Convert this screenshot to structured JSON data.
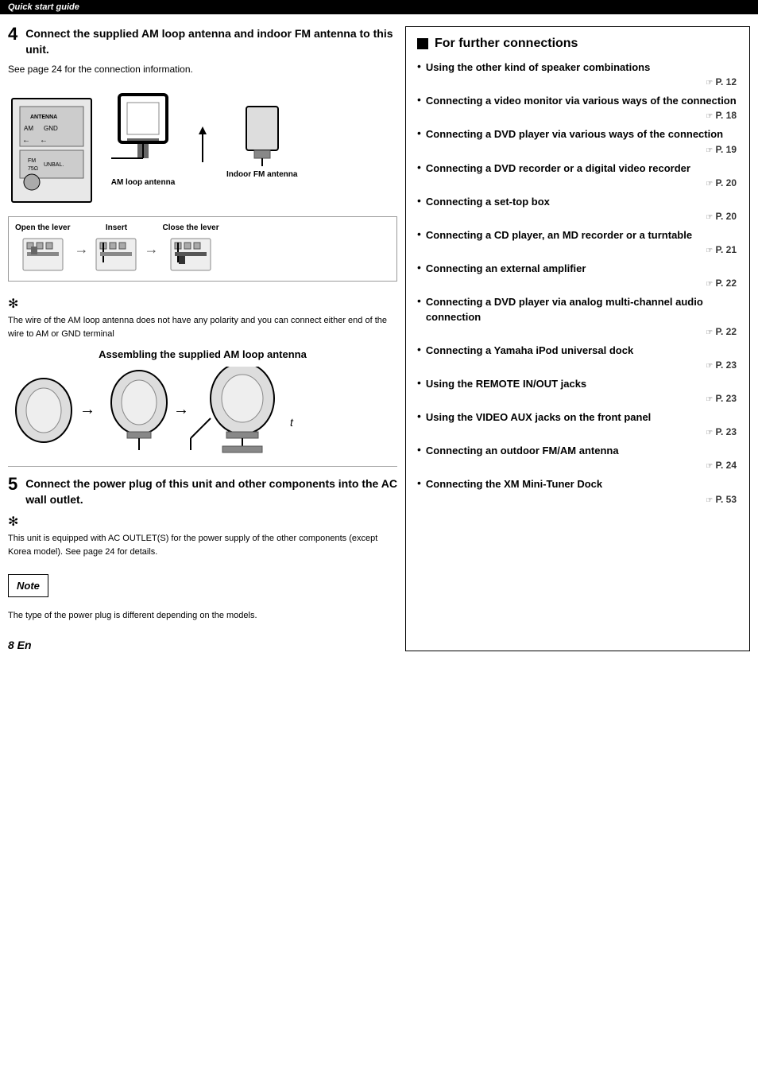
{
  "header": {
    "label": "Quick start guide"
  },
  "left": {
    "section4": {
      "number": "4",
      "title": "Connect the supplied AM loop antenna and indoor FM antenna to this unit.",
      "subtitle": "See page 24 for the connection information.",
      "am_label": "AM loop antenna",
      "fm_label": "Indoor FM antenna",
      "lever_steps": [
        {
          "label": "Open the lever"
        },
        {
          "label": "Insert"
        },
        {
          "label": "Close the lever"
        }
      ],
      "note_text": "The wire of the AM loop antenna does not have any polarity and you can connect either end of the wire to AM or GND terminal",
      "assembling_title": "Assembling the supplied AM loop antenna"
    },
    "section5": {
      "number": "5",
      "title": "Connect the power plug of this unit and other components into the AC wall outlet.",
      "note_text": "This unit is equipped with AC OUTLET(S) for the power supply of the other components (except Korea model). See page 24 for details.",
      "note_label": "Note",
      "note_body": "The type of the power plug is different depending on the models."
    },
    "page_number": "8 En"
  },
  "right": {
    "title": "For further connections",
    "items": [
      {
        "text": "Using the other kind of speaker combinations",
        "page": "P. 12"
      },
      {
        "text": "Connecting a video monitor via various ways of the connection",
        "page": "P. 18"
      },
      {
        "text": "Connecting a DVD player via various ways of the connection",
        "page": "P. 19"
      },
      {
        "text": "Connecting a DVD recorder or a digital video recorder",
        "page": "P. 20"
      },
      {
        "text": "Connecting a set-top box",
        "page": "P. 20"
      },
      {
        "text": "Connecting a CD player, an MD recorder or a turntable",
        "page": "P. 21"
      },
      {
        "text": "Connecting an external amplifier",
        "page": "P. 22"
      },
      {
        "text": "Connecting a DVD player via analog multi-channel audio connection",
        "page": "P. 22"
      },
      {
        "text": "Connecting a Yamaha iPod universal dock",
        "page": "P. 23"
      },
      {
        "text": "Using the REMOTE IN/OUT jacks",
        "page": "P. 23"
      },
      {
        "text": "Using the VIDEO AUX jacks on the front panel",
        "page": "P. 23"
      },
      {
        "text": "Connecting an outdoor FM/AM antenna",
        "page": "P. 24"
      },
      {
        "text": "Connecting the XM Mini-Tuner Dock",
        "page": "P. 53"
      }
    ]
  }
}
